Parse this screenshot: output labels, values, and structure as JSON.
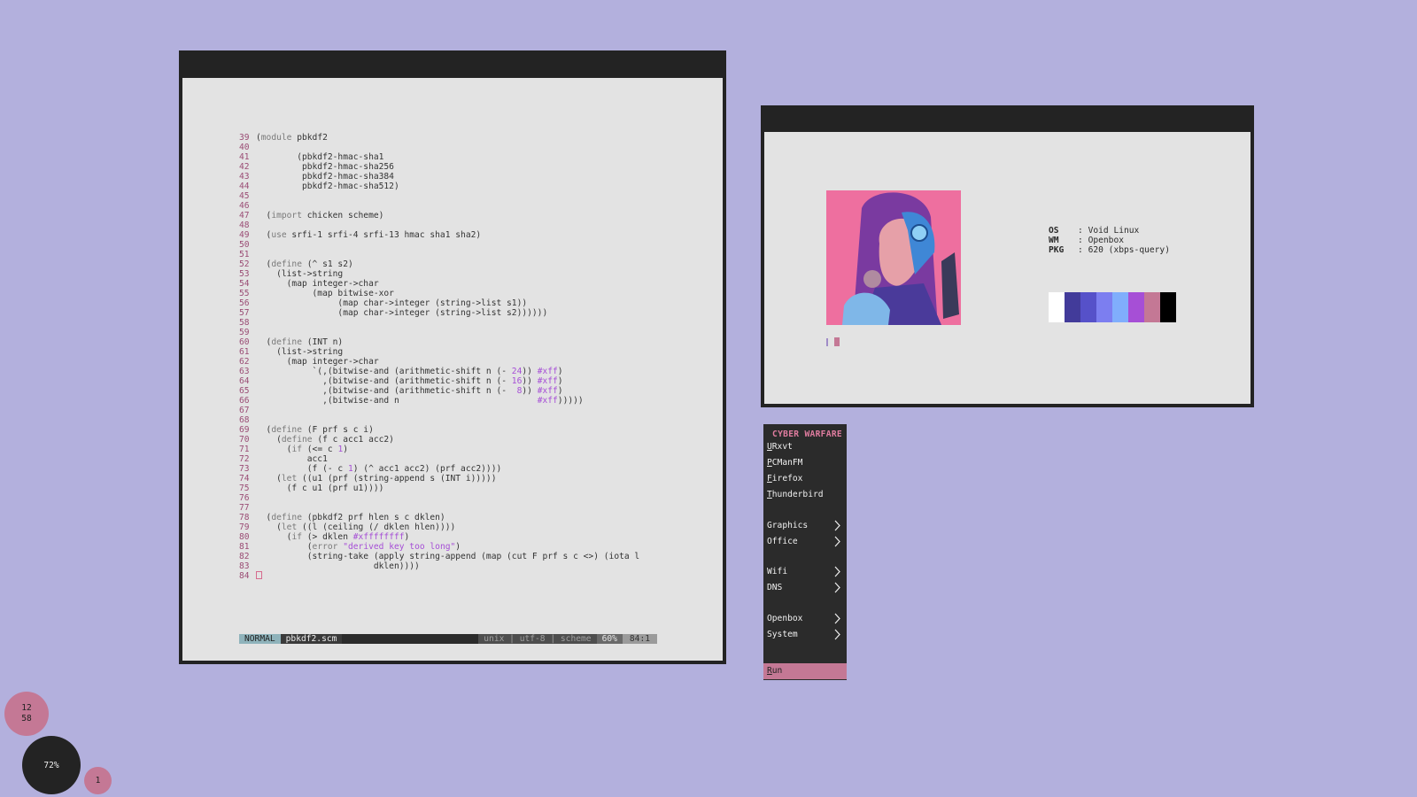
{
  "editor": {
    "lines": [
      {
        "n": "39",
        "code": "(module pbkdf2"
      },
      {
        "n": "40",
        "code": ""
      },
      {
        "n": "41",
        "code": "        (pbkdf2-hmac-sha1"
      },
      {
        "n": "42",
        "code": "         pbkdf2-hmac-sha256"
      },
      {
        "n": "43",
        "code": "         pbkdf2-hmac-sha384"
      },
      {
        "n": "44",
        "code": "         pbkdf2-hmac-sha512)"
      },
      {
        "n": "45",
        "code": ""
      },
      {
        "n": "46",
        "code": ""
      },
      {
        "n": "47",
        "code": "  (import chicken scheme)"
      },
      {
        "n": "48",
        "code": ""
      },
      {
        "n": "49",
        "code": "  (use srfi-1 srfi-4 srfi-13 hmac sha1 sha2)"
      },
      {
        "n": "50",
        "code": ""
      },
      {
        "n": "51",
        "code": ""
      },
      {
        "n": "52",
        "code": "  (define (^ s1 s2)"
      },
      {
        "n": "53",
        "code": "    (list->string"
      },
      {
        "n": "54",
        "code": "      (map integer->char"
      },
      {
        "n": "55",
        "code": "           (map bitwise-xor"
      },
      {
        "n": "56",
        "code": "                (map char->integer (string->list s1))"
      },
      {
        "n": "57",
        "code": "                (map char->integer (string->list s2))))))"
      },
      {
        "n": "58",
        "code": ""
      },
      {
        "n": "59",
        "code": ""
      },
      {
        "n": "60",
        "code": "  (define (INT n)"
      },
      {
        "n": "61",
        "code": "    (list->string"
      },
      {
        "n": "62",
        "code": "      (map integer->char"
      },
      {
        "n": "63",
        "code": "           `(,(bitwise-and (arithmetic-shift n (- 24)) #xff)"
      },
      {
        "n": "64",
        "code": "             ,(bitwise-and (arithmetic-shift n (- 16)) #xff)"
      },
      {
        "n": "65",
        "code": "             ,(bitwise-and (arithmetic-shift n (-  8)) #xff)"
      },
      {
        "n": "66",
        "code": "             ,(bitwise-and n                           #xff)))))"
      },
      {
        "n": "67",
        "code": ""
      },
      {
        "n": "68",
        "code": ""
      },
      {
        "n": "69",
        "code": "  (define (F prf s c i)"
      },
      {
        "n": "70",
        "code": "    (define (f c acc1 acc2)"
      },
      {
        "n": "71",
        "code": "      (if (<= c 1)"
      },
      {
        "n": "72",
        "code": "          acc1"
      },
      {
        "n": "73",
        "code": "          (f (- c 1) (^ acc1 acc2) (prf acc2))))"
      },
      {
        "n": "74",
        "code": "    (let ((u1 (prf (string-append s (INT i)))))"
      },
      {
        "n": "75",
        "code": "      (f c u1 (prf u1))))"
      },
      {
        "n": "76",
        "code": ""
      },
      {
        "n": "77",
        "code": ""
      },
      {
        "n": "78",
        "code": "  (define (pbkdf2 prf hlen s c dklen)"
      },
      {
        "n": "79",
        "code": "    (let ((l (ceiling (/ dklen hlen))))"
      },
      {
        "n": "80",
        "code": "      (if (> dklen #xffffffff)"
      },
      {
        "n": "81",
        "code": "          (error \"derived key too long\")"
      },
      {
        "n": "82",
        "code": "          (string-take (apply string-append (map (cut F prf s c <>) (iota l"
      },
      {
        "n": "83",
        "code": "                       dklen))))"
      },
      {
        "n": "84",
        "code": ""
      }
    ],
    "status": {
      "mode": "NORMAL",
      "file": "pbkdf2.scm",
      "info": "unix | utf-8 | scheme",
      "percent": "60%",
      "position": "84:1"
    }
  },
  "fetch": {
    "info": [
      {
        "key": "OS",
        "value": "Void Linux"
      },
      {
        "key": "WM",
        "value": "Openbox"
      },
      {
        "key": "PKG",
        "value": "620 (xbps-query)"
      }
    ],
    "avatar_text": "CYBER WARFARE",
    "palette": [
      "#ffffff",
      "#423b9a",
      "#5651c9",
      "#7c7ef0",
      "#80aefc",
      "#a64fd6",
      "#c47895",
      "#000000"
    ]
  },
  "menu": {
    "title": "CYBER WARFARE",
    "items": [
      {
        "label": "URxvt",
        "hot": "U",
        "rest": "Rxvt"
      },
      {
        "label": "PCManFM",
        "hot": "P",
        "rest": "CManFM"
      },
      {
        "label": "Firefox",
        "hot": "F",
        "rest": "irefox"
      },
      {
        "label": "Thunderbird",
        "hot": "T",
        "rest": "hunderbird"
      },
      {
        "label": "Graphics"
      },
      {
        "label": "Office"
      },
      {
        "label": "Wifi"
      },
      {
        "label": "DNS"
      },
      {
        "label": "Openbox"
      },
      {
        "label": "System"
      }
    ],
    "run": {
      "hot": "R",
      "rest": "un"
    }
  },
  "bubbles": {
    "hour": "12",
    "minute": "58",
    "battery": "72%",
    "workspace": "1"
  }
}
